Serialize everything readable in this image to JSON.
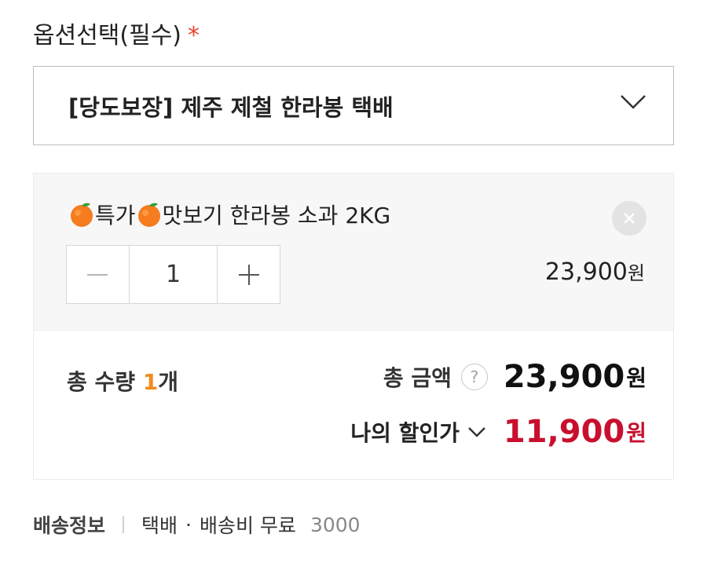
{
  "option": {
    "label": "옵션선택(필수)",
    "required_mark": "*",
    "selected": "[당도보장] 제주 제철 한라봉 택배"
  },
  "item": {
    "name_prefix": "특가",
    "name_suffix": "맛보기 한라봉 소과 2KG",
    "icon": "orange-icon",
    "quantity": "1",
    "price": "23,900",
    "price_unit": "원"
  },
  "summary": {
    "total_qty_label": "총 수량 ",
    "total_qty_value": "1",
    "total_qty_unit": "개",
    "total_amount_label": "총 금액",
    "help": "?",
    "total_amount": "23,900",
    "total_amount_unit": "원",
    "discount_label": "나의 할인가",
    "discount_amount": "11,900",
    "discount_unit": "원"
  },
  "shipping": {
    "title": "배송정보",
    "method": "택배",
    "dot": "·",
    "fee_label": "배송비 무료",
    "fee_amount": "3000"
  },
  "colors": {
    "accent_orange": "#f08c1e",
    "discount_red": "#c8102e",
    "required_red": "#e8452c"
  }
}
